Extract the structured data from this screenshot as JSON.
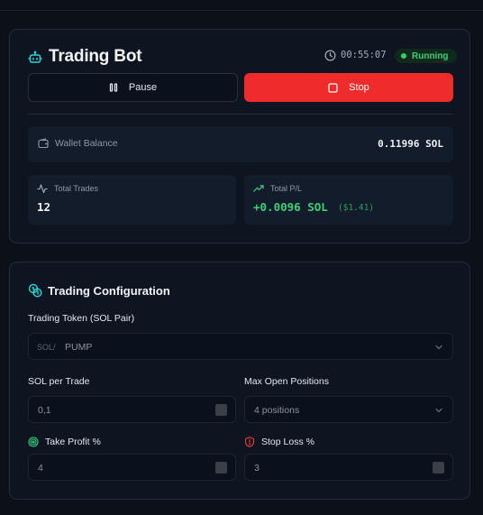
{
  "bot": {
    "title": "Trading Bot",
    "timer": "00:55:07",
    "status": "Running",
    "pause_label": "Pause",
    "stop_label": "Stop",
    "wallet_label": "Wallet Balance",
    "wallet_value": "0.11996 SOL",
    "trades_label": "Total Trades",
    "trades_value": "12",
    "pl_label": "Total P/L",
    "pl_value": "+0.0096 SOL",
    "pl_usd": "($1.41)"
  },
  "config": {
    "title": "Trading Configuration",
    "token_label": "Trading Token (SOL Pair)",
    "token_prefix": "SOL/",
    "token_value": "PUMP",
    "sol_label": "SOL per Trade",
    "sol_value": "0,1",
    "max_label": "Max Open Positions",
    "max_value": "4 positions",
    "tp_label": "Take Profit %",
    "tp_value": "4",
    "sl_label": "Stop Loss %",
    "sl_value": "3"
  },
  "colors": {
    "accent": "#2ed3d3",
    "stop": "#ef2b2b",
    "running": "#3fcf7a",
    "stop_loss_icon": "#ef3b3b",
    "take_profit_icon": "#35d07f"
  },
  "icons": [
    "bot-icon",
    "clock-icon",
    "pause-icon",
    "stop-icon",
    "wallet-icon",
    "activity-icon",
    "trending-up-icon",
    "coins-icon",
    "chevron-down-icon",
    "target-icon",
    "alert-shield-icon"
  ]
}
